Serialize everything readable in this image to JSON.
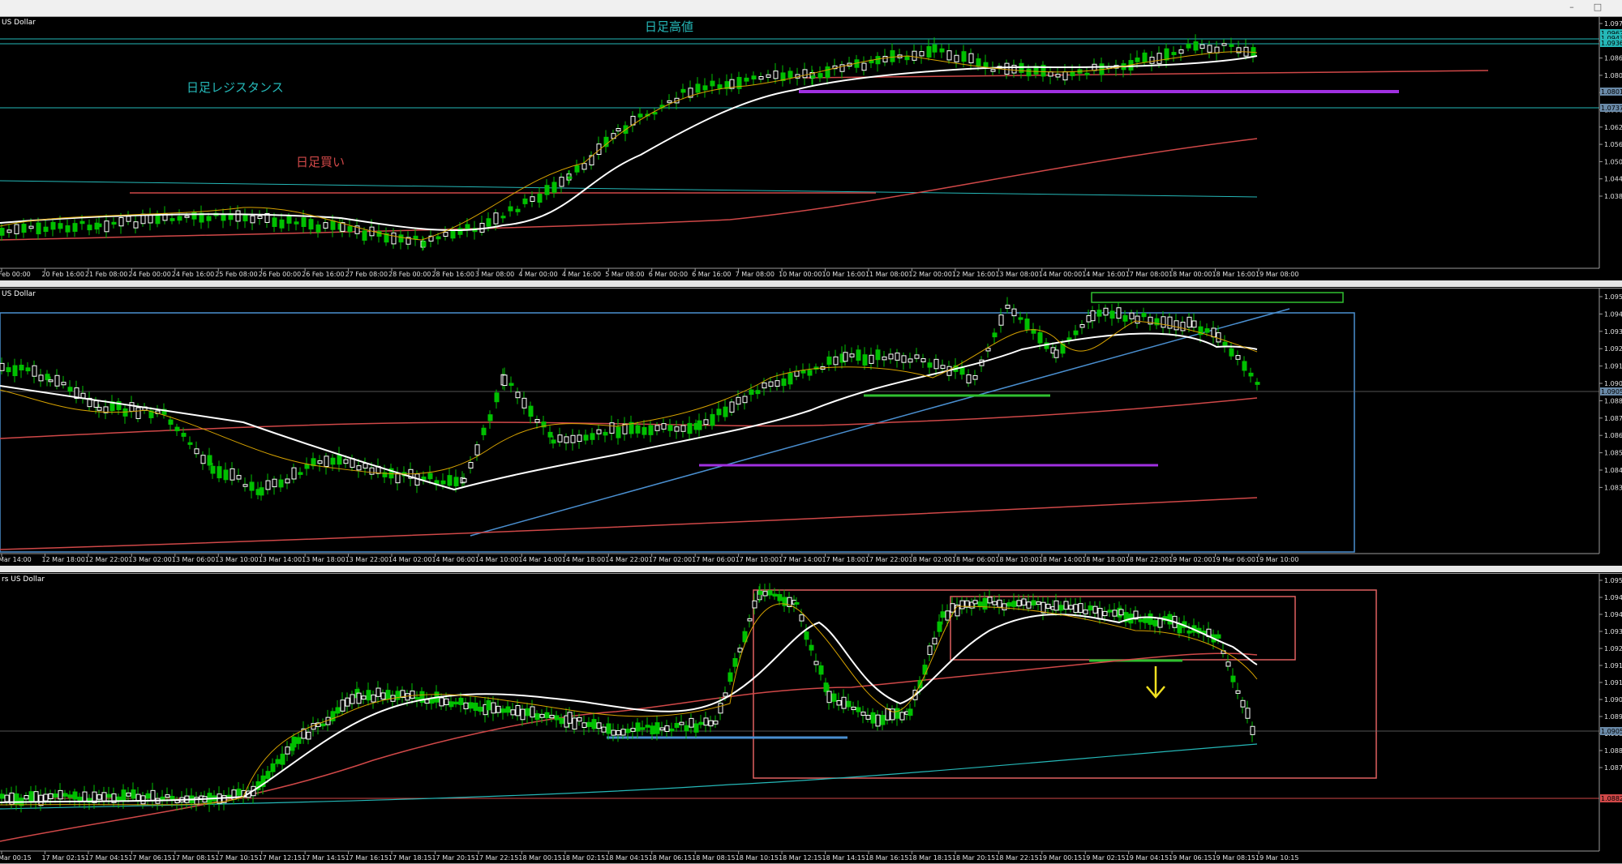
{
  "window": {
    "controls": [
      "–",
      "□",
      "✕"
    ]
  },
  "colors": {
    "bg": "#000000",
    "grid": "#2a2a2a",
    "bull": "#ffffff",
    "bear": "#00c000",
    "sma_fast": "#d6a200",
    "sma_white": "#ffffff",
    "sma_red": "#d04848",
    "cyan": "#25b8b8"
  },
  "panels": [
    {
      "title": "US Dollar",
      "annotations": [
        {
          "text": "日足高値",
          "color": "#25b8b8"
        },
        {
          "text": "日足レジスタンス",
          "color": "#25b8b8"
        },
        {
          "text": "日足買い",
          "color": "#d04848"
        }
      ],
      "price_ticks": [
        "1.0978",
        "1.0919",
        "1.0860",
        "1.0801",
        "1.0742",
        "1.0683",
        "1.0624",
        "1.0565",
        "1.0506",
        "1.0447",
        "1.0388"
      ],
      "price_badges": [
        "1.0962",
        "1.0943",
        "1.0936",
        "1.0801",
        "1.0737"
      ],
      "time_ticks": [
        "Feb 00:00",
        "20 Feb 16:00",
        "21 Feb 08:00",
        "24 Feb 00:00",
        "24 Feb 16:00",
        "25 Feb 08:00",
        "26 Feb 00:00",
        "26 Feb 16:00",
        "27 Feb 08:00",
        "28 Feb 00:00",
        "28 Feb 16:00",
        "3 Mar 08:00",
        "4 Mar 00:00",
        "4 Mar 16:00",
        "5 Mar 08:00",
        "6 Mar 00:00",
        "6 Mar 16:00",
        "7 Mar 08:00",
        "10 Mar 00:00",
        "10 Mar 16:00",
        "11 Mar 08:00",
        "12 Mar 00:00",
        "12 Mar 16:00",
        "13 Mar 08:00",
        "14 Mar 00:00",
        "14 Mar 16:00",
        "17 Mar 08:00",
        "18 Mar 00:00",
        "18 Mar 16:00",
        "19 Mar 08:00"
      ]
    },
    {
      "title": "US Dollar",
      "price_ticks": [
        "1.0958",
        "1.0946",
        "1.0935",
        "1.0923",
        "1.0912",
        "1.0900",
        "1.0889",
        "1.0877",
        "1.0866",
        "1.0854",
        "1.0843",
        "1.0831"
      ],
      "price_badges": [
        "1.0905"
      ],
      "time_ticks": [
        "Mar 14:00",
        "12 Mar 18:00",
        "12 Mar 22:00",
        "13 Mar 02:00",
        "13 Mar 06:00",
        "13 Mar 10:00",
        "13 Mar 14:00",
        "13 Mar 18:00",
        "13 Mar 22:00",
        "14 Mar 02:00",
        "14 Mar 06:00",
        "14 Mar 10:00",
        "14 Mar 14:00",
        "14 Mar 18:00",
        "14 Mar 22:00",
        "17 Mar 02:00",
        "17 Mar 06:00",
        "17 Mar 10:00",
        "17 Mar 14:00",
        "17 Mar 18:00",
        "17 Mar 22:00",
        "18 Mar 02:00",
        "18 Mar 06:00",
        "18 Mar 10:00",
        "18 Mar 14:00",
        "18 Mar 18:00",
        "18 Mar 22:00",
        "19 Mar 02:00",
        "19 Mar 06:00",
        "19 Mar 10:00"
      ]
    },
    {
      "title": "rs US Dollar",
      "price_ticks": [
        "1.0957",
        "1.0949",
        "1.0942",
        "1.0934",
        "1.0927",
        "1.0919",
        "1.0912",
        "1.0904",
        "1.0897",
        "1.0889",
        "1.0882",
        "1.0874"
      ],
      "price_badges": [
        "1.0905",
        "1.0882"
      ],
      "time_ticks": [
        "Mar 00:15",
        "17 Mar 02:15",
        "17 Mar 04:15",
        "17 Mar 06:15",
        "17 Mar 08:15",
        "17 Mar 10:15",
        "17 Mar 12:15",
        "17 Mar 14:15",
        "17 Mar 16:15",
        "17 Mar 18:15",
        "17 Mar 20:15",
        "17 Mar 22:15",
        "18 Mar 00:15",
        "18 Mar 02:15",
        "18 Mar 04:15",
        "18 Mar 06:15",
        "18 Mar 08:15",
        "18 Mar 10:15",
        "18 Mar 12:15",
        "18 Mar 14:15",
        "18 Mar 16:15",
        "18 Mar 18:15",
        "18 Mar 20:15",
        "18 Mar 22:15",
        "19 Mar 00:15",
        "19 Mar 02:15",
        "19 Mar 04:15",
        "19 Mar 06:15",
        "19 Mar 08:15",
        "19 Mar 10:15"
      ]
    }
  ]
}
